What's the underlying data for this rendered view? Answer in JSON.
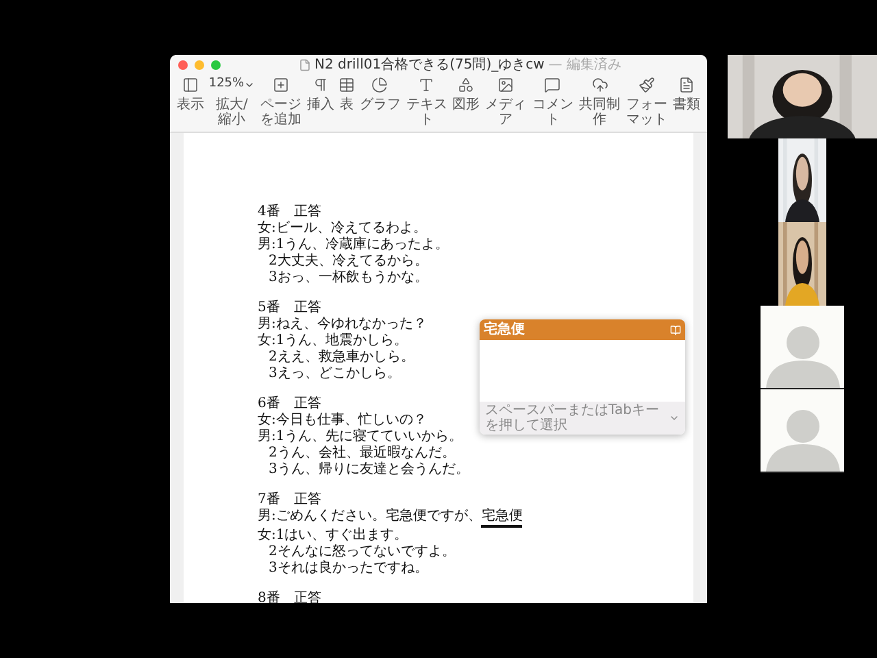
{
  "window": {
    "title": "N2 drill01合格できる(75問)_ゆきcw",
    "status": "— 編集済み"
  },
  "toolbar": [
    {
      "kind": "icon",
      "label": "表示"
    },
    {
      "kind": "zoom",
      "value": "125%",
      "label": "拡大/縮小"
    },
    {
      "kind": "icon",
      "label": "ページを追加"
    },
    {
      "kind": "icon",
      "label": "挿入"
    },
    {
      "kind": "icon",
      "label": "表"
    },
    {
      "kind": "icon",
      "label": "グラフ"
    },
    {
      "kind": "icon",
      "label": "テキスト"
    },
    {
      "kind": "icon",
      "label": "図形"
    },
    {
      "kind": "icon",
      "label": "メディア"
    },
    {
      "kind": "icon",
      "label": "コメント"
    },
    {
      "kind": "icon",
      "label": "共同制作"
    },
    {
      "kind": "icon",
      "label": "フォーマット"
    },
    {
      "kind": "icon",
      "label": "書類"
    }
  ],
  "document": {
    "questions": [
      {
        "heading": "4番　正答",
        "lines": [
          {
            "kind": "speaker",
            "text": "女:ビール、冷えてるわよ。"
          },
          {
            "kind": "speaker",
            "text": "男:1うん、冷蔵庫にあったよ。"
          },
          {
            "kind": "option",
            "text": "2大丈夫、冷えてるから。"
          },
          {
            "kind": "option",
            "text": "3おっ、一杯飲もうかな。"
          }
        ]
      },
      {
        "heading": "5番　正答",
        "lines": [
          {
            "kind": "speaker",
            "text": "男:ねえ、今ゆれなかった？"
          },
          {
            "kind": "speaker",
            "text": "女:1うん、地震かしら。"
          },
          {
            "kind": "option",
            "text": "2ええ、救急車かしら。"
          },
          {
            "kind": "option",
            "text": "3えっ、どこかしら。"
          }
        ]
      },
      {
        "heading": "6番　正答",
        "lines": [
          {
            "kind": "speaker",
            "text": "女:今日も仕事、忙しいの？"
          },
          {
            "kind": "speaker",
            "text": "男:1うん、先に寝てていいから。"
          },
          {
            "kind": "option",
            "text": "2うん、会社、最近暇なんだ。"
          },
          {
            "kind": "option",
            "text": "3うん、帰りに友達と会うんだ。"
          }
        ]
      },
      {
        "heading": "7番　正答",
        "lines": [
          {
            "kind": "speaker",
            "text": "男:ごめんください。宅急便ですが、",
            "composing": "宅急便"
          },
          {
            "kind": "speaker",
            "text": "女:1はい、すぐ出ます。"
          },
          {
            "kind": "option",
            "text": "2そんなに怒ってないですよ。"
          },
          {
            "kind": "option",
            "text": "3それは良かったですね。"
          }
        ]
      },
      {
        "heading": "8番　正答"
      }
    ]
  },
  "candidate_popup": {
    "candidate": "宅急便",
    "hint": "スペースバーまたはTabキーを押して選択"
  },
  "participants": [
    {
      "kind": "video"
    },
    {
      "kind": "video"
    },
    {
      "kind": "video"
    },
    {
      "kind": "avatar"
    },
    {
      "kind": "avatar"
    }
  ]
}
